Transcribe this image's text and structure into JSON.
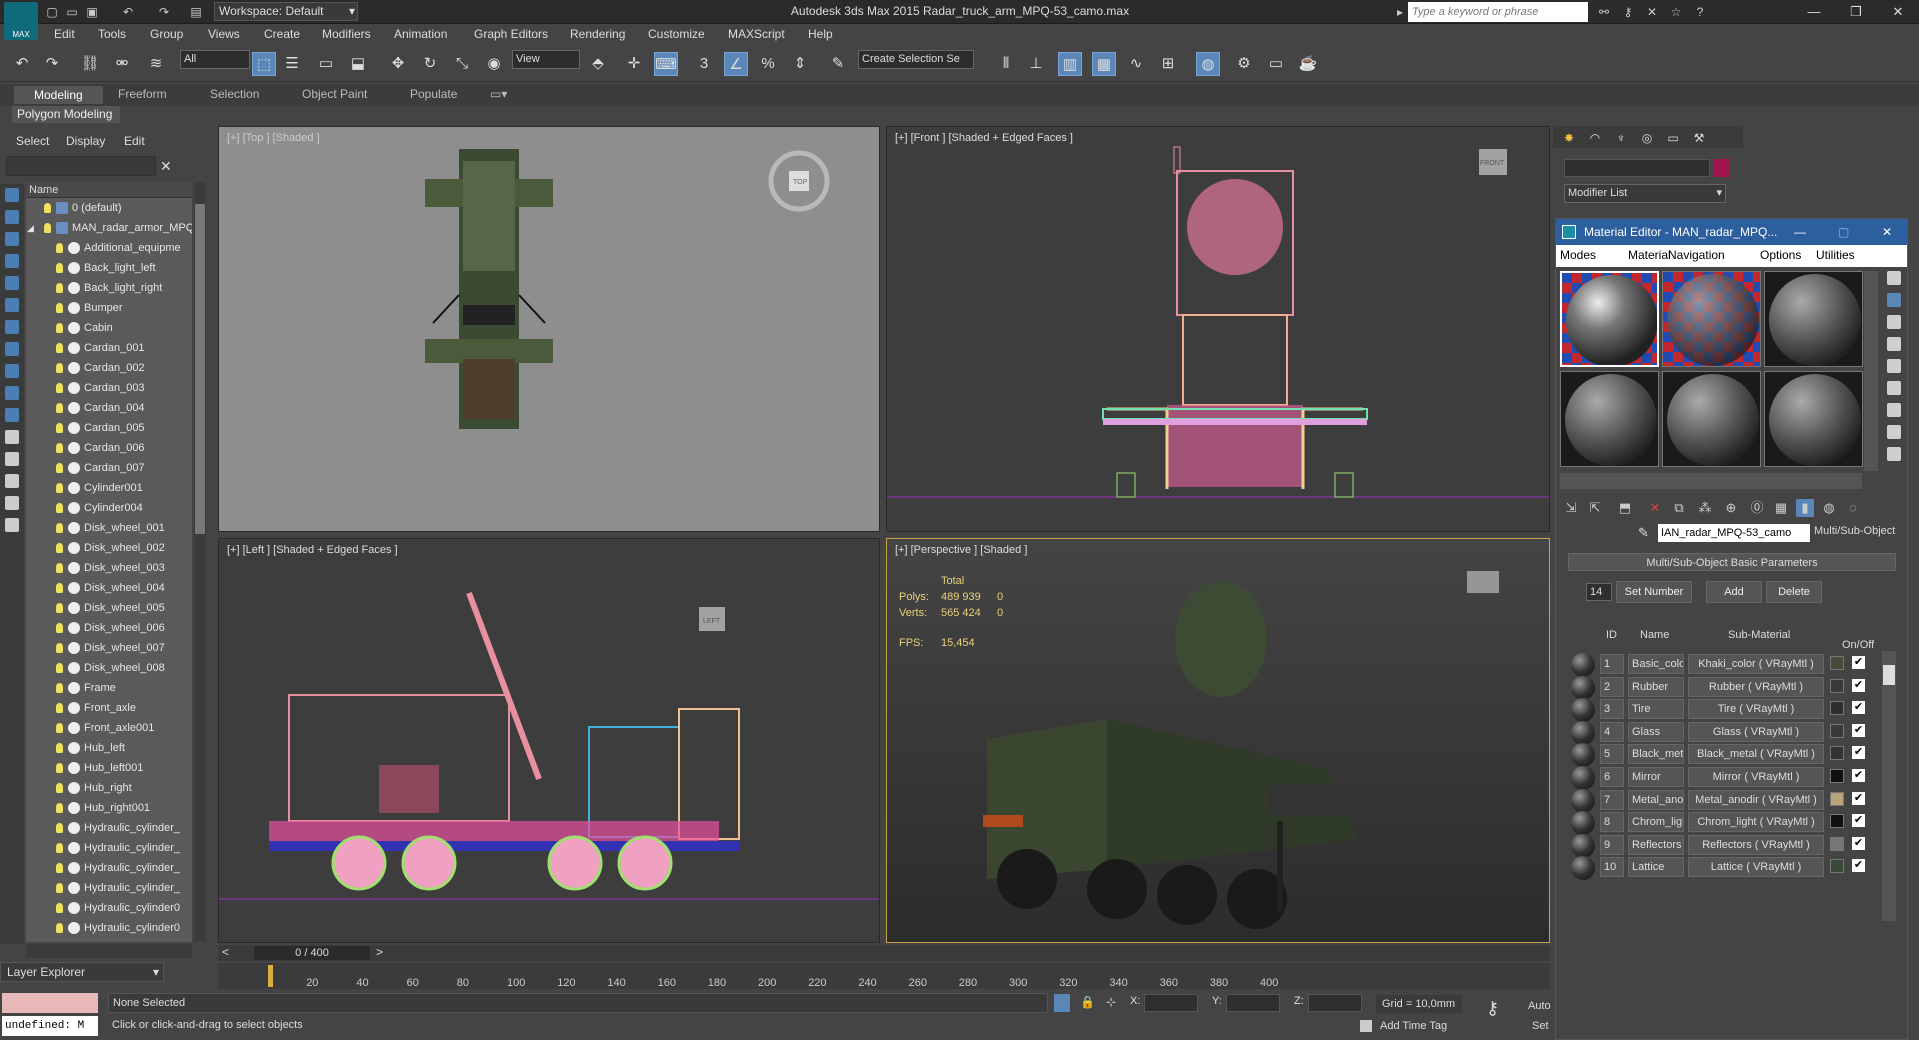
{
  "app": {
    "logo_text": "MAX",
    "workspace": "Workspace: Default",
    "window_title": "Autodesk 3ds Max 2015    Radar_truck_arm_MPQ-53_camo.max",
    "keyword_placeholder": "Type a keyword or phrase"
  },
  "menu": [
    "Edit",
    "Tools",
    "Group",
    "Views",
    "Create",
    "Modifiers",
    "Animation",
    "Graph Editors",
    "Rendering",
    "Customize",
    "MAXScript",
    "Help"
  ],
  "toolbar": {
    "selection_filter": "All",
    "ref_coord": "View",
    "named_selection": "Create Selection Se",
    "snap_label": "3"
  },
  "ribbon": {
    "tabs": [
      "Modeling",
      "Freeform",
      "Selection",
      "Object Paint",
      "Populate"
    ],
    "panel": "Polygon Modeling"
  },
  "explorer": {
    "menu": [
      "Select",
      "Display",
      "Edit"
    ],
    "column_header": "Name",
    "items": [
      {
        "label": "0 (default)",
        "level": 0
      },
      {
        "label": "MAN_radar_armor_MPQ",
        "level": 0
      },
      {
        "label": "Additional_equipme",
        "level": 1
      },
      {
        "label": "Back_light_left",
        "level": 1
      },
      {
        "label": "Back_light_right",
        "level": 1
      },
      {
        "label": "Bumper",
        "level": 1
      },
      {
        "label": "Cabin",
        "level": 1
      },
      {
        "label": "Cardan_001",
        "level": 1
      },
      {
        "label": "Cardan_002",
        "level": 1
      },
      {
        "label": "Cardan_003",
        "level": 1
      },
      {
        "label": "Cardan_004",
        "level": 1
      },
      {
        "label": "Cardan_005",
        "level": 1
      },
      {
        "label": "Cardan_006",
        "level": 1
      },
      {
        "label": "Cardan_007",
        "level": 1
      },
      {
        "label": "Cylinder001",
        "level": 1
      },
      {
        "label": "Cylinder004",
        "level": 1
      },
      {
        "label": "Disk_wheel_001",
        "level": 1
      },
      {
        "label": "Disk_wheel_002",
        "level": 1
      },
      {
        "label": "Disk_wheel_003",
        "level": 1
      },
      {
        "label": "Disk_wheel_004",
        "level": 1
      },
      {
        "label": "Disk_wheel_005",
        "level": 1
      },
      {
        "label": "Disk_wheel_006",
        "level": 1
      },
      {
        "label": "Disk_wheel_007",
        "level": 1
      },
      {
        "label": "Disk_wheel_008",
        "level": 1
      },
      {
        "label": "Frame",
        "level": 1
      },
      {
        "label": "Front_axle",
        "level": 1
      },
      {
        "label": "Front_axle001",
        "level": 1
      },
      {
        "label": "Hub_left",
        "level": 1
      },
      {
        "label": "Hub_left001",
        "level": 1
      },
      {
        "label": "Hub_right",
        "level": 1
      },
      {
        "label": "Hub_right001",
        "level": 1
      },
      {
        "label": "Hydraulic_cylinder_",
        "level": 1
      },
      {
        "label": "Hydraulic_cylinder_",
        "level": 1
      },
      {
        "label": "Hydraulic_cylinder_",
        "level": 1
      },
      {
        "label": "Hydraulic_cylinder_",
        "level": 1
      },
      {
        "label": "Hydraulic_cylinder0",
        "level": 1
      },
      {
        "label": "Hydraulic_cylinder0",
        "level": 1
      }
    ],
    "footer": "Layer Explorer"
  },
  "viewports": {
    "top": {
      "label": "[+] [Top ] [Shaded ]",
      "cube": "TOP"
    },
    "front": {
      "label": "[+] [Front ] [Shaded + Edged Faces ]",
      "cube": "FRONT"
    },
    "left": {
      "label": "[+] [Left ] [Shaded + Edged Faces ]",
      "cube": "LEFT"
    },
    "perspective": {
      "label": "[+] [Perspective ] [Shaded ]"
    }
  },
  "stats": {
    "total_label": "Total",
    "polys_label": "Polys:",
    "polys": "489 939",
    "polys_sel": "0",
    "verts_label": "Verts:",
    "verts": "565 424",
    "verts_sel": "0",
    "fps_label": "FPS:",
    "fps": "15,454"
  },
  "timeline": {
    "slider": "0 / 400",
    "ticks": [
      "0",
      "20",
      "40",
      "60",
      "80",
      "100",
      "120",
      "140",
      "160",
      "180",
      "200",
      "220",
      "240",
      "260",
      "280",
      "300",
      "320",
      "340",
      "360",
      "380",
      "400"
    ]
  },
  "status": {
    "maxscript": "undefined: M",
    "selection": "None Selected",
    "prompt": "Click or click-and-drag to select objects",
    "x": "X:",
    "y": "Y:",
    "z": "Z:",
    "grid": "Grid = 10,0mm",
    "add_time_tag": "Add Time Tag",
    "auto": "Auto",
    "set": "Set"
  },
  "command_panel": {
    "modifier_list": "Modifier List"
  },
  "material_editor": {
    "title": "Material Editor - MAN_radar_MPQ...",
    "menu": [
      "Modes",
      "Material",
      "Navigation",
      "Options",
      "Utilities"
    ],
    "material_name": "IAN_radar_MPQ-53_camo",
    "type": "Multi/Sub-Object",
    "rollout": "Multi/Sub-Object Basic Parameters",
    "count": "14",
    "set_number": "Set Number",
    "add": "Add",
    "delete": "Delete",
    "col_id": "ID",
    "col_name": "Name",
    "col_sub": "Sub-Material",
    "col_onoff": "On/Off",
    "subs": [
      {
        "id": "1",
        "name": "Basic_color",
        "mat": "Khaki_color ( VRayMtl )",
        "color": "#4a4a3a"
      },
      {
        "id": "2",
        "name": "Rubber",
        "mat": "Rubber ( VRayMtl )",
        "color": "#3a3a3a"
      },
      {
        "id": "3",
        "name": "Tire",
        "mat": "Tire ( VRayMtl )",
        "color": "#2e2e2e"
      },
      {
        "id": "4",
        "name": "Glass",
        "mat": "Glass ( VRayMtl )",
        "color": "#3a3a3a"
      },
      {
        "id": "5",
        "name": "Black_meta",
        "mat": "Black_metal ( VRayMtl )",
        "color": "#333333"
      },
      {
        "id": "6",
        "name": "Mirror",
        "mat": "Mirror ( VRayMtl )",
        "color": "#111111"
      },
      {
        "id": "7",
        "name": "Metal_ano",
        "mat": "Metal_anodir ( VRayMtl )",
        "color": "#b8a37a"
      },
      {
        "id": "8",
        "name": "Chrom_ligh",
        "mat": "Chrom_light ( VRayMtl )",
        "color": "#111111"
      },
      {
        "id": "9",
        "name": "Reflectors",
        "mat": "Reflectors ( VRayMtl )",
        "color": "#777777"
      },
      {
        "id": "10",
        "name": "Lattice",
        "mat": "Lattice ( VRayMtl )",
        "color": "#3a4a3a"
      }
    ]
  }
}
